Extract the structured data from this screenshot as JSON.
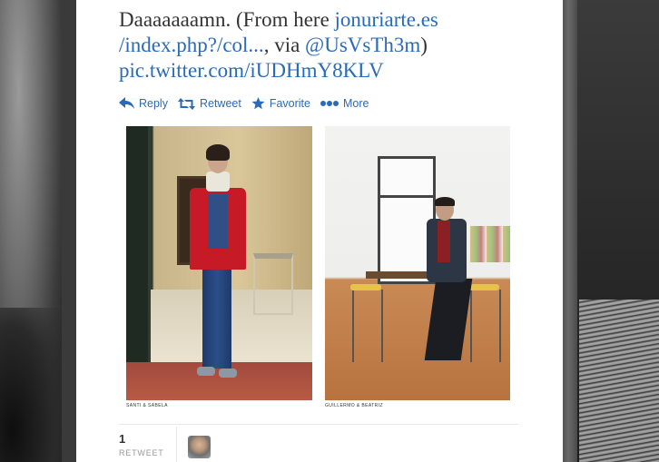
{
  "tweet": {
    "text_plain_1": "Daaaaaaamn. (From here ",
    "link_1": "jonuriarte.es /index.php?/col...",
    "text_plain_2": ", via ",
    "mention": "@UsVsTh3m",
    "text_plain_3": ")",
    "pic_link": "pic.twitter.com/iUDHmY8KLV"
  },
  "actions": {
    "reply": "Reply",
    "retweet": "Retweet",
    "favorite": "Favorite",
    "more": "More"
  },
  "media": {
    "caption_left": "SANTI & SABELA",
    "caption_right": "GUILLERMO & BEATRIZ"
  },
  "stats": {
    "retweet_count": "1",
    "retweet_label": "RETWEET"
  },
  "colors": {
    "link": "#2a6ab8",
    "text": "#333333"
  }
}
